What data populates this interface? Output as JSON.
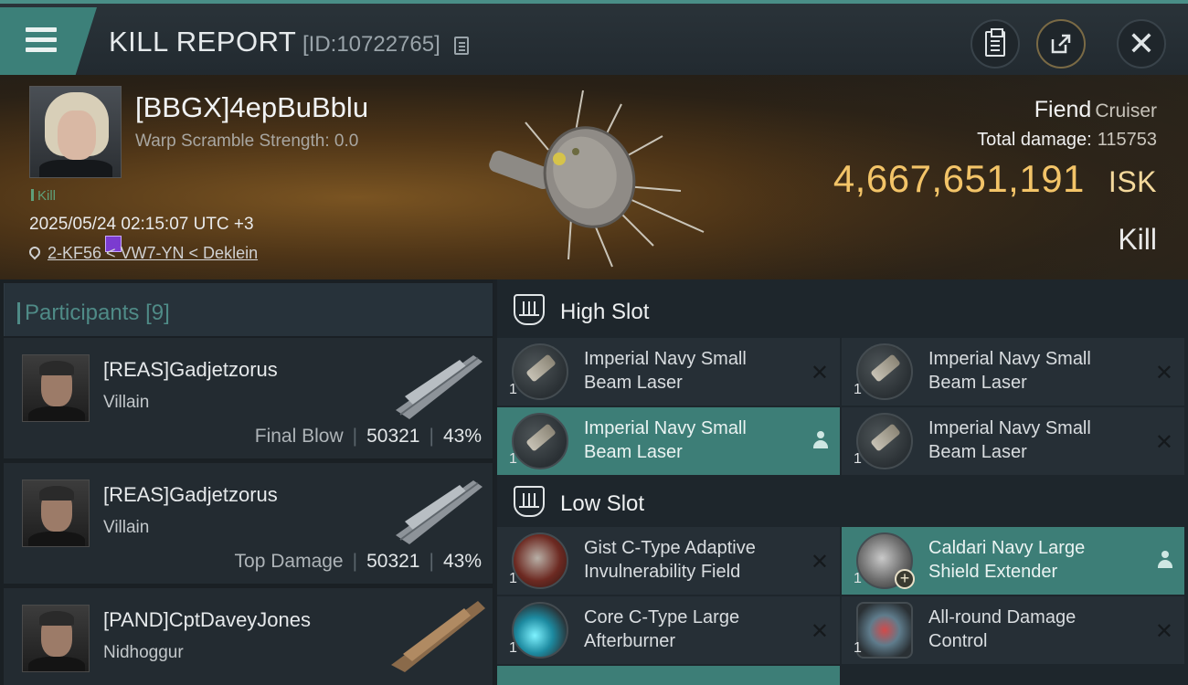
{
  "header": {
    "title": "KILL REPORT",
    "report_id": "[ID:10722765]"
  },
  "victim": {
    "name": "[BBGX]4epBuBblu",
    "warp_scramble": "Warp Scramble Strength: 0.0",
    "kill_tag": "Kill",
    "timestamp": "2025/05/24 02:15:07 UTC +3",
    "location": "2-KF56 < VW7-YN < Deklein"
  },
  "ship": {
    "name": "Fiend",
    "class": "Cruiser",
    "total_damage_label": "Total damage:",
    "total_damage": "115753",
    "isk_value": "4,667,651,191",
    "isk_unit": "ISK",
    "result": "Kill"
  },
  "participants": {
    "label": "Participants",
    "count": "[9]",
    "rows": [
      {
        "name": "[REAS]Gadjetzorus",
        "ship": "Villain",
        "role": "Final Blow",
        "damage": "50321",
        "percent": "43%"
      },
      {
        "name": "[REAS]Gadjetzorus",
        "ship": "Villain",
        "role": "Top Damage",
        "damage": "50321",
        "percent": "43%"
      },
      {
        "name": "[PAND]CptDaveyJones",
        "ship": "Nidhoggur",
        "role": "",
        "damage": "",
        "percent": ""
      }
    ]
  },
  "fitting": {
    "high_slot": {
      "title": "High Slot",
      "modules": [
        {
          "name": "Imperial Navy Small Beam Laser",
          "qty": "1",
          "status": "destroyed"
        },
        {
          "name": "Imperial Navy Small Beam Laser",
          "qty": "1",
          "status": "destroyed"
        },
        {
          "name": "Imperial Navy Small Beam Laser",
          "qty": "1",
          "status": "dropped"
        },
        {
          "name": "Imperial Navy Small Beam Laser",
          "qty": "1",
          "status": "destroyed"
        }
      ]
    },
    "low_slot": {
      "title": "Low Slot",
      "modules": [
        {
          "name": "Gist C-Type Adaptive Invulnerability Field",
          "qty": "1",
          "status": "destroyed"
        },
        {
          "name": "Caldari Navy Large Shield Extender",
          "qty": "1",
          "status": "dropped"
        },
        {
          "name": "Core C-Type Large Afterburner",
          "qty": "1",
          "status": "destroyed"
        },
        {
          "name": "All-round Damage Control",
          "qty": "1",
          "status": "destroyed"
        }
      ]
    }
  },
  "colors": {
    "accent": "#3d7e77",
    "isk": "#f3c468"
  }
}
